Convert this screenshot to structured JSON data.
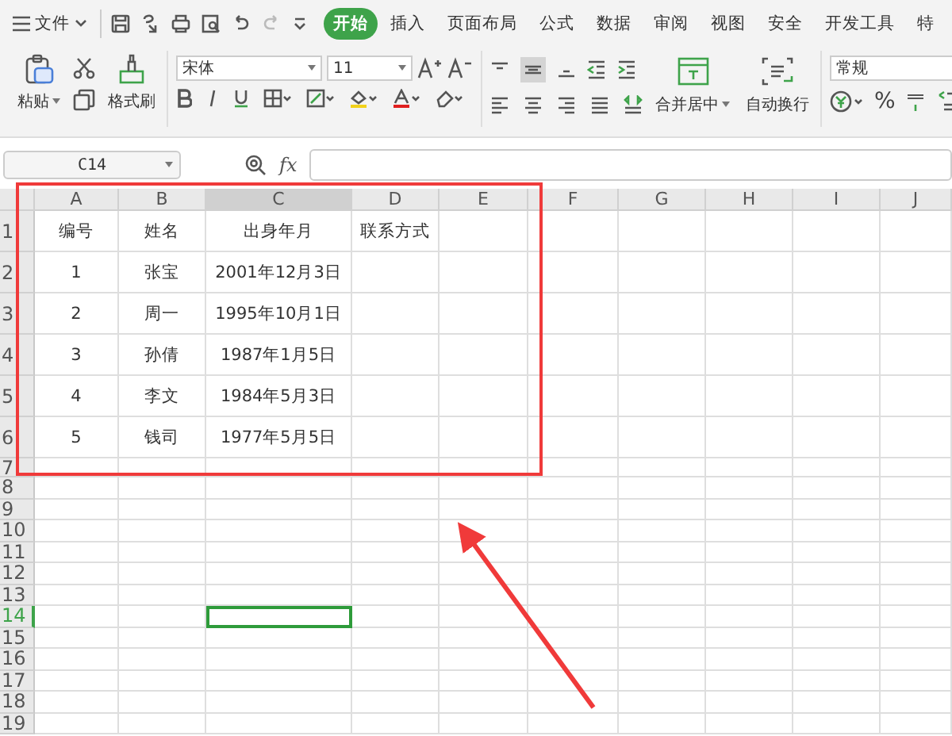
{
  "menu": {
    "file": "文件",
    "tabs": [
      {
        "label": "开始",
        "selected": true
      },
      {
        "label": "插入",
        "selected": false
      },
      {
        "label": "页面布局",
        "selected": false
      },
      {
        "label": "公式",
        "selected": false
      },
      {
        "label": "数据",
        "selected": false
      },
      {
        "label": "审阅",
        "selected": false
      },
      {
        "label": "视图",
        "selected": false
      },
      {
        "label": "安全",
        "selected": false
      },
      {
        "label": "开发工具",
        "selected": false
      },
      {
        "label": "特",
        "selected": false
      }
    ]
  },
  "ribbon": {
    "paste": "粘贴",
    "format_painter": "格式刷",
    "font_name": "宋体",
    "font_size": "11",
    "merge_center": "合并居中",
    "wrap_text": "自动换行",
    "number_format": "常规",
    "percent": "%"
  },
  "formula_bar": {
    "name_box": "C14",
    "fx": "fx"
  },
  "sheet": {
    "columns": [
      {
        "label": "A",
        "selected": false
      },
      {
        "label": "B",
        "selected": false
      },
      {
        "label": "C",
        "selected": true
      },
      {
        "label": "D",
        "selected": false
      },
      {
        "label": "E",
        "selected": false
      },
      {
        "label": "F",
        "selected": false
      },
      {
        "label": "G",
        "selected": false
      },
      {
        "label": "H",
        "selected": false
      },
      {
        "label": "I",
        "selected": false
      },
      {
        "label": "J",
        "selected": false
      }
    ],
    "rows": [
      {
        "label": "1",
        "selected": false,
        "cells": [
          "编号",
          "姓名",
          "出身年月",
          "联系方式"
        ]
      },
      {
        "label": "2",
        "selected": false,
        "cells": [
          "1",
          "张宝",
          "2001年12月3日"
        ]
      },
      {
        "label": "3",
        "selected": false,
        "cells": [
          "2",
          "周一",
          "1995年10月1日"
        ]
      },
      {
        "label": "4",
        "selected": false,
        "cells": [
          "3",
          "孙倩",
          "1987年1月5日"
        ]
      },
      {
        "label": "5",
        "selected": false,
        "cells": [
          "4",
          "李文",
          "1984年5月3日"
        ]
      },
      {
        "label": "6",
        "selected": false,
        "cells": [
          "5",
          "钱司",
          "1977年5月5日"
        ]
      },
      {
        "label": "7",
        "selected": false,
        "cells": []
      },
      {
        "label": "8",
        "selected": false,
        "cells": []
      },
      {
        "label": "9",
        "selected": false,
        "cells": []
      },
      {
        "label": "10",
        "selected": false,
        "cells": []
      },
      {
        "label": "11",
        "selected": false,
        "cells": []
      },
      {
        "label": "12",
        "selected": false,
        "cells": []
      },
      {
        "label": "13",
        "selected": false,
        "cells": []
      },
      {
        "label": "14",
        "selected": true,
        "cells": []
      },
      {
        "label": "15",
        "selected": false,
        "cells": []
      },
      {
        "label": "16",
        "selected": false,
        "cells": []
      },
      {
        "label": "17",
        "selected": false,
        "cells": []
      },
      {
        "label": "18",
        "selected": false,
        "cells": []
      },
      {
        "label": "19",
        "selected": false,
        "cells": []
      }
    ]
  }
}
